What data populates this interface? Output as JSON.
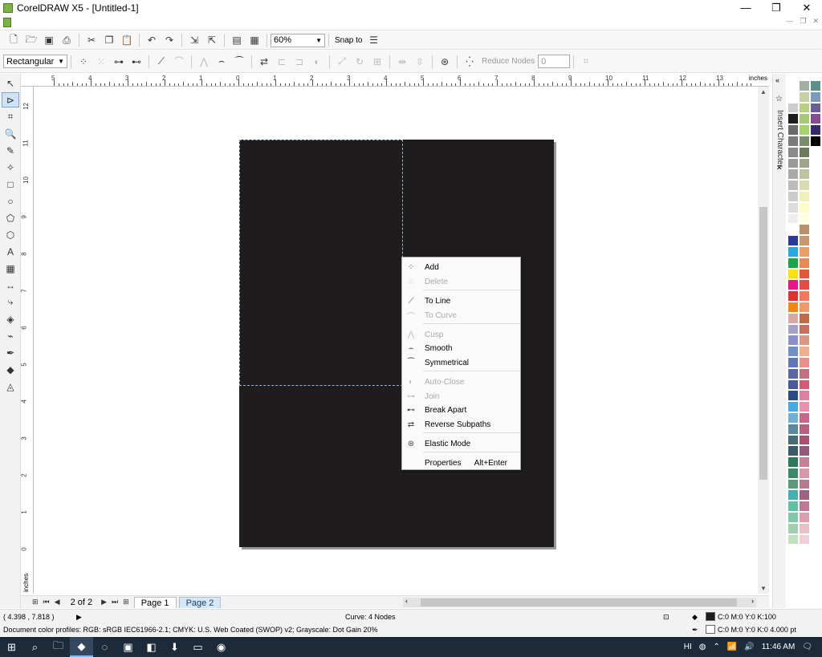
{
  "window": {
    "title": "CorelDRAW X5 - [Untitled-1]",
    "minimize": "—",
    "restore": "❐",
    "close": "✕"
  },
  "standard_toolbar": {
    "zoom_value": "60%",
    "snap_to_label": "Snap to"
  },
  "property_bar": {
    "shape_select": "Rectangular",
    "reduce_nodes_label": "Reduce Nodes",
    "reduce_nodes_value": "0"
  },
  "ruler": {
    "unit": "inches",
    "h_labels": [
      "5",
      "4",
      "3",
      "2",
      "1",
      "0",
      "1",
      "2",
      "3",
      "4",
      "5",
      "6",
      "7",
      "8",
      "9",
      "10",
      "11",
      "12",
      "13"
    ],
    "v_labels": [
      "12",
      "11",
      "10",
      "9",
      "8",
      "7",
      "6",
      "5",
      "4",
      "3",
      "2",
      "1",
      "0"
    ]
  },
  "docker": {
    "title": "Insert Character"
  },
  "page_nav": {
    "count": "2 of 2",
    "tabs": [
      "Page 1",
      "Page 2"
    ]
  },
  "status": {
    "coords": "( 4.398 , 7.818 )",
    "object_info": "Curve: 4 Nodes",
    "color_profiles": "Document color profiles: RGB: sRGB IEC61966-2.1; CMYK: U.S. Web Coated (SWOP) v2; Grayscale: Dot Gain 20%",
    "fill_info": "C:0 M:0 Y:0 K:100",
    "outline_info": "C:0 M:0 Y:0 K:0   4.000 pt"
  },
  "context_menu": {
    "items": [
      {
        "label": "Add",
        "icon": "add-node-icon",
        "glyph": "⁘",
        "enabled": true
      },
      {
        "label": "Delete",
        "icon": "delete-node-icon",
        "glyph": "⁙",
        "enabled": false
      },
      {
        "label": "To Line",
        "icon": "to-line-icon",
        "glyph": "⟋",
        "enabled": true
      },
      {
        "label": "To Curve",
        "icon": "to-curve-icon",
        "glyph": "⌒",
        "enabled": false
      },
      {
        "label": "Cusp",
        "icon": "cusp-icon",
        "glyph": "⋀",
        "enabled": false
      },
      {
        "label": "Smooth",
        "icon": "smooth-icon",
        "glyph": "⌢",
        "enabled": true
      },
      {
        "label": "Symmetrical",
        "icon": "symmetrical-icon",
        "glyph": "⁀",
        "enabled": true
      },
      {
        "label": "Auto-Close",
        "icon": "auto-close-icon",
        "glyph": "◐",
        "enabled": false
      },
      {
        "label": "Join",
        "icon": "join-icon",
        "glyph": "⊶",
        "enabled": false
      },
      {
        "label": "Break Apart",
        "icon": "break-apart-icon",
        "glyph": "⊷",
        "enabled": true
      },
      {
        "label": "Reverse Subpaths",
        "icon": "reverse-subpaths-icon",
        "glyph": "⇄",
        "enabled": true
      },
      {
        "label": "Elastic Mode",
        "icon": "elastic-mode-icon",
        "glyph": "⊛",
        "enabled": true
      },
      {
        "label": "Properties",
        "shortcut": "Alt+Enter",
        "enabled": true
      }
    ]
  },
  "taskbar": {
    "lang": "HI",
    "time": "11:46 AM"
  },
  "palette_colors": [
    "#ffffff",
    "#9fb29f",
    "#5b8f8c",
    "#ffffff",
    "#c3d1a4",
    "#7a9bbd",
    "#cccccc",
    "#b9cf84",
    "#6d5b98",
    "#1f1c1e",
    "#a6c878",
    "#8a4a8f",
    "#6a6a6a",
    "#a6d26b",
    "#3b2a6a",
    "#7a7a7a",
    "#7b8a6b",
    "#000000",
    "#8a8a8a",
    "#6b7a5a",
    "#ffffff",
    "#9a9a9a",
    "#9fa58a",
    "#ffffff",
    "#aaaaaa",
    "#bcc49f",
    "#ffffff",
    "#bbbbbb",
    "#d8dcb0",
    "#ffffff",
    "#cccccc",
    "#f0f0b8",
    "#ffffff",
    "#dddddd",
    "#fdfdc8",
    "#ffffff",
    "#eeeeee",
    "#fffee0",
    "#ffffff",
    "#ffffff",
    "#b8926a",
    "#ffffff",
    "#2c3a94",
    "#c8986f",
    "#ffffff",
    "#28a8e0",
    "#e8a068",
    "#ffffff",
    "#18a848",
    "#e88a58",
    "#ffffff",
    "#ffe010",
    "#e05a3a",
    "#ffffff",
    "#e8168a",
    "#e84a48",
    "#ffffff",
    "#e03030",
    "#f07a5a",
    "#ffffff",
    "#f08818",
    "#f09a6a",
    "#ffffff",
    "#d8a8a8",
    "#c06a4a",
    "#ffffff",
    "#a8a0c8",
    "#c87060",
    "#ffffff",
    "#8a90c8",
    "#d89a80",
    "#ffffff",
    "#7090c8",
    "#f0b090",
    "#ffffff",
    "#6078b8",
    "#e8908a",
    "#ffffff",
    "#5a68a8",
    "#c07080",
    "#ffffff",
    "#4a5a98",
    "#d05a78",
    "#ffffff",
    "#2a4a88",
    "#e080a0",
    "#ffffff",
    "#48a8e0",
    "#e890b0",
    "#ffffff",
    "#70b0d8",
    "#c86888",
    "#ffffff",
    "#5a8aa0",
    "#b86080",
    "#ffffff",
    "#4a6a7a",
    "#a85070",
    "#ffffff",
    "#3a5a6a",
    "#905a78",
    "#ffffff",
    "#2a7a5a",
    "#c88098",
    "#ffffff",
    "#3a8a6a",
    "#d898a8",
    "#ffffff",
    "#5a9a7a",
    "#b87890",
    "#ffffff",
    "#40b0b0",
    "#a06080",
    "#ffffff",
    "#60c0a0",
    "#c07898",
    "#ffffff",
    "#80c8a8",
    "#d8a0b0",
    "#ffffff",
    "#a0d0b0",
    "#e8c0c8",
    "#ffffff",
    "#c0e0c0",
    "#f0d0d8",
    "#ffffff"
  ]
}
